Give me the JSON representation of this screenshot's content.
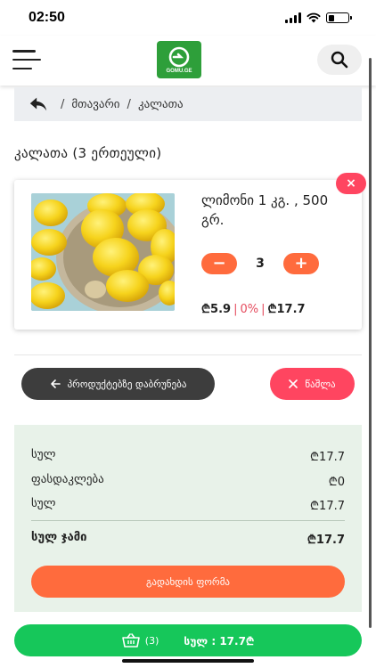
{
  "status_bar": {
    "time": "02:50"
  },
  "header": {
    "logo_text": "GOMU.GE",
    "brand_color": "#2e9f3a"
  },
  "breadcrumb": {
    "home": "მთავარი",
    "current": "კალათა",
    "separator": "/"
  },
  "page": {
    "title": "კალათა (3 ერთეული)"
  },
  "cart_items": [
    {
      "name": "ლიმონი 1 კგ. , 500 გრ.",
      "quantity": "3",
      "minus_label": "−",
      "plus_label": "+",
      "unit_price": "₾5.9",
      "discount": "0%",
      "line_total": "₾17.7",
      "remove_label": "×"
    }
  ],
  "actions": {
    "back_to_products": "პროდუქტებზე დაბრუნება",
    "delete": "წაშლა"
  },
  "summary": {
    "rows": [
      {
        "label": "სულ",
        "value": "₾17.7"
      },
      {
        "label": "ფასდაკლება",
        "value": "₾0"
      },
      {
        "label": "სულ",
        "value": "₾17.7"
      }
    ],
    "grand_total_label": "სულ ჯამი",
    "grand_total_value": "₾17.7",
    "checkout_label": "გადახდის ფორმა"
  },
  "bottom_bar": {
    "count": "(3)",
    "total_text": "სულ : 17.7₾"
  },
  "colors": {
    "accent_orange": "#ff6b3d",
    "danger": "#ff4560",
    "cart_green": "#16c75a",
    "summary_bg": "#e8f2e9"
  }
}
